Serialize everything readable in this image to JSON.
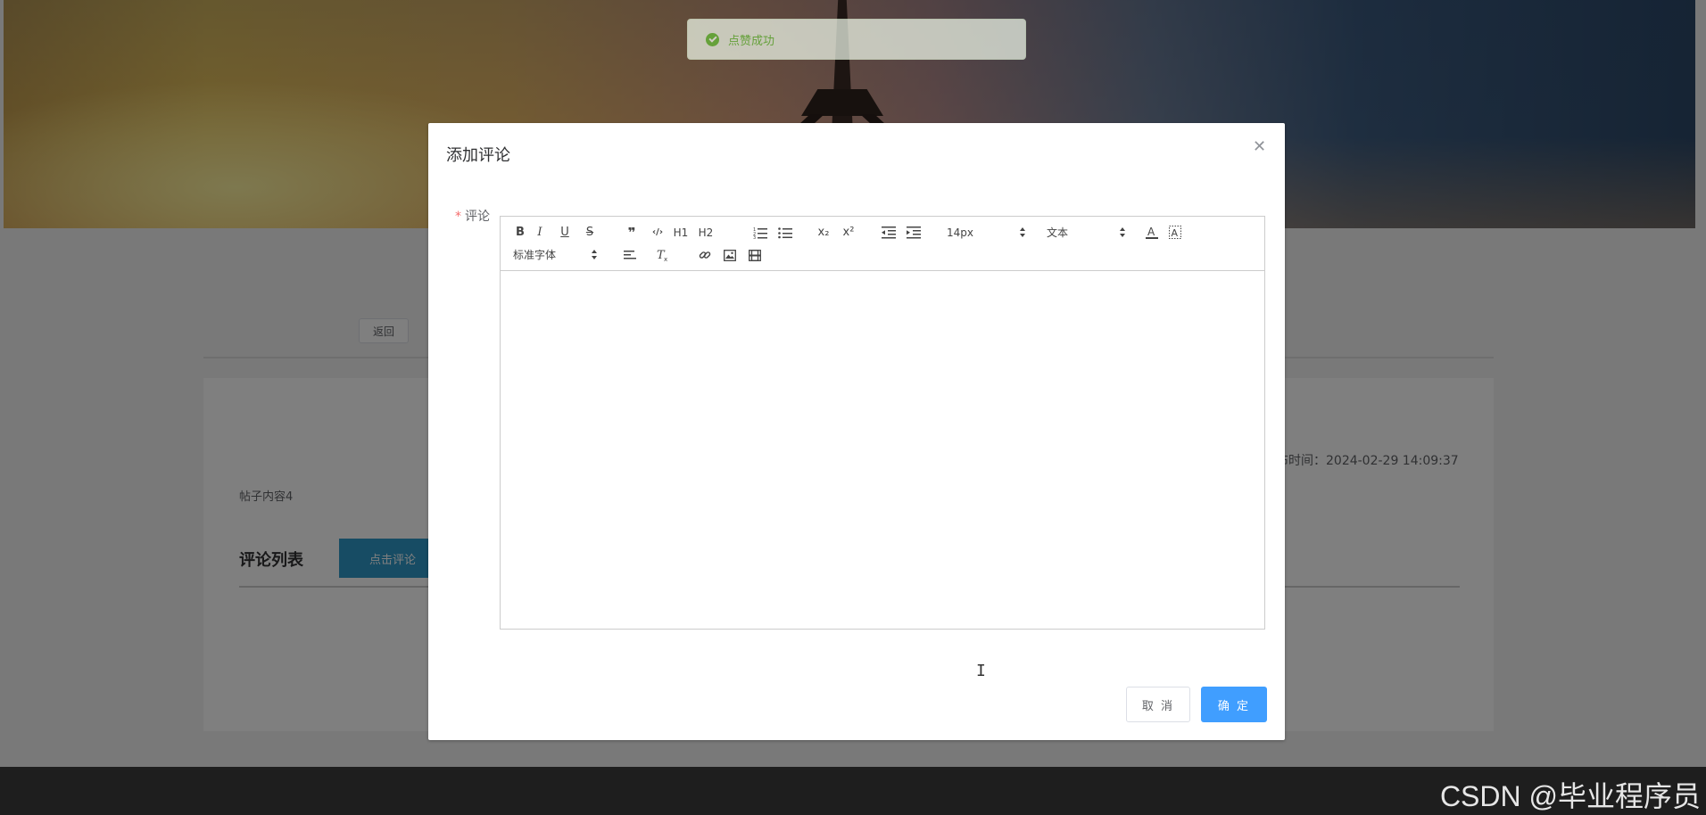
{
  "page": {
    "back_label": "返回",
    "post_time": "布时间：2024-02-29 14:09:37",
    "post_content": "帖子内容4",
    "comment_list_title": "评论列表",
    "click_comment_label": "点击评论"
  },
  "toast": {
    "message": "点赞成功",
    "icon": "check-circle-icon",
    "color": "#67c23a"
  },
  "dialog": {
    "title": "添加评论",
    "close_icon": "close-icon",
    "field_label": "评论",
    "required_mark": "*",
    "cancel_label": "取 消",
    "confirm_label": "确 定",
    "confirm_color": "#409eff"
  },
  "editor": {
    "toolbar": {
      "bold": "B",
      "italic": "I",
      "underline": "U",
      "strike": "S",
      "blockquote": "❞",
      "code": "‹/›",
      "h1": "H1",
      "h2": "H2",
      "subscript": "x₂",
      "superscript": "x²",
      "size_value": "14px",
      "header_value": "文本",
      "font_value": "标准字体"
    },
    "content": ""
  },
  "watermark": "CSDN @毕业程序员"
}
